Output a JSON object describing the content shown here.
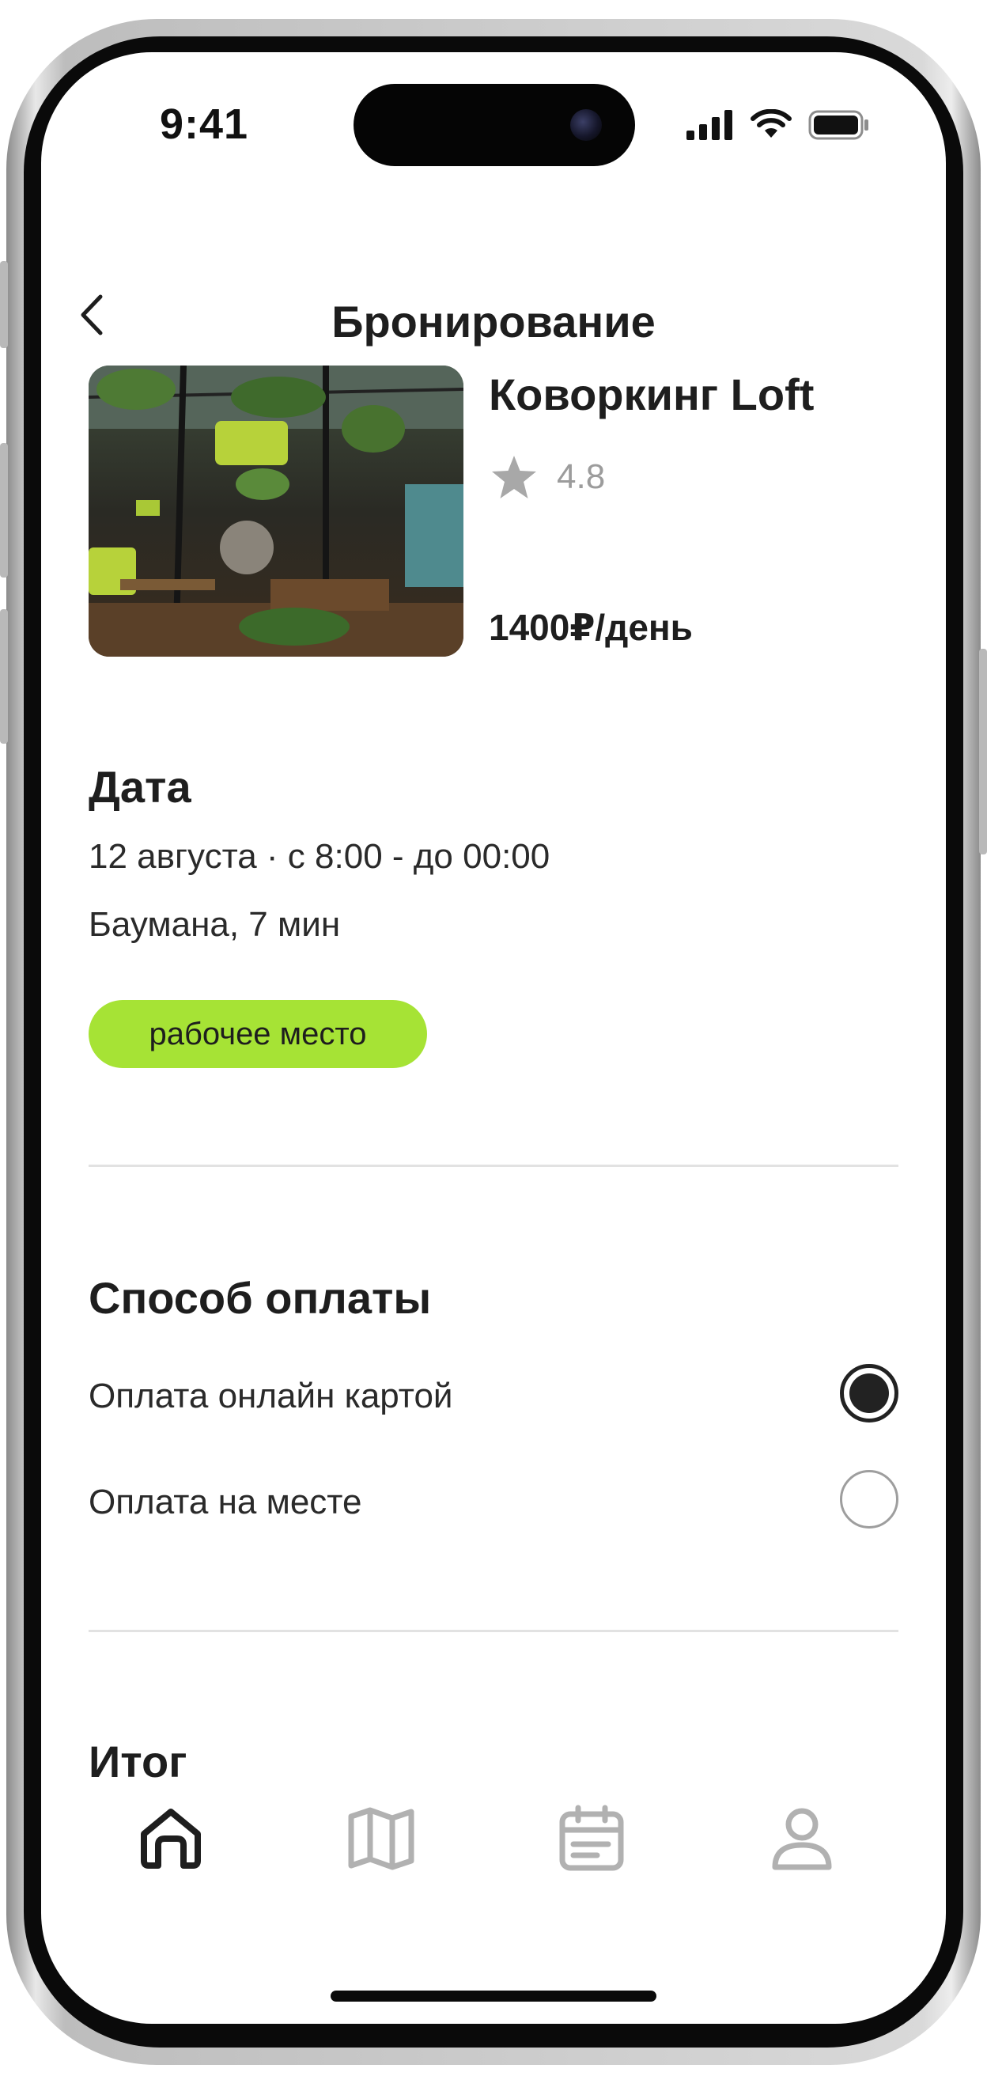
{
  "status_bar": {
    "time": "9:41"
  },
  "header": {
    "title": "Бронирование"
  },
  "venue": {
    "name": "Коворкинг Loft",
    "rating": "4.8",
    "price": "1400₽/день"
  },
  "date_section": {
    "title": "Дата",
    "datetime": "12 августа · с 8:00 - до 00:00",
    "metro": "Баумана, 7 мин",
    "tag": "рабочее место"
  },
  "payment": {
    "title": "Способ оплаты",
    "options": [
      {
        "label": "Оплата онлайн картой",
        "selected": true
      },
      {
        "label": "Оплата на месте",
        "selected": false
      }
    ]
  },
  "summary": {
    "title": "Итог"
  },
  "nav": {
    "active": "home",
    "items": [
      "home-icon",
      "map-icon",
      "calendar-icon",
      "profile-icon"
    ]
  },
  "colors": {
    "accent": "#a6e335",
    "text": "#1e1e1e",
    "muted": "#9c9c9c"
  }
}
